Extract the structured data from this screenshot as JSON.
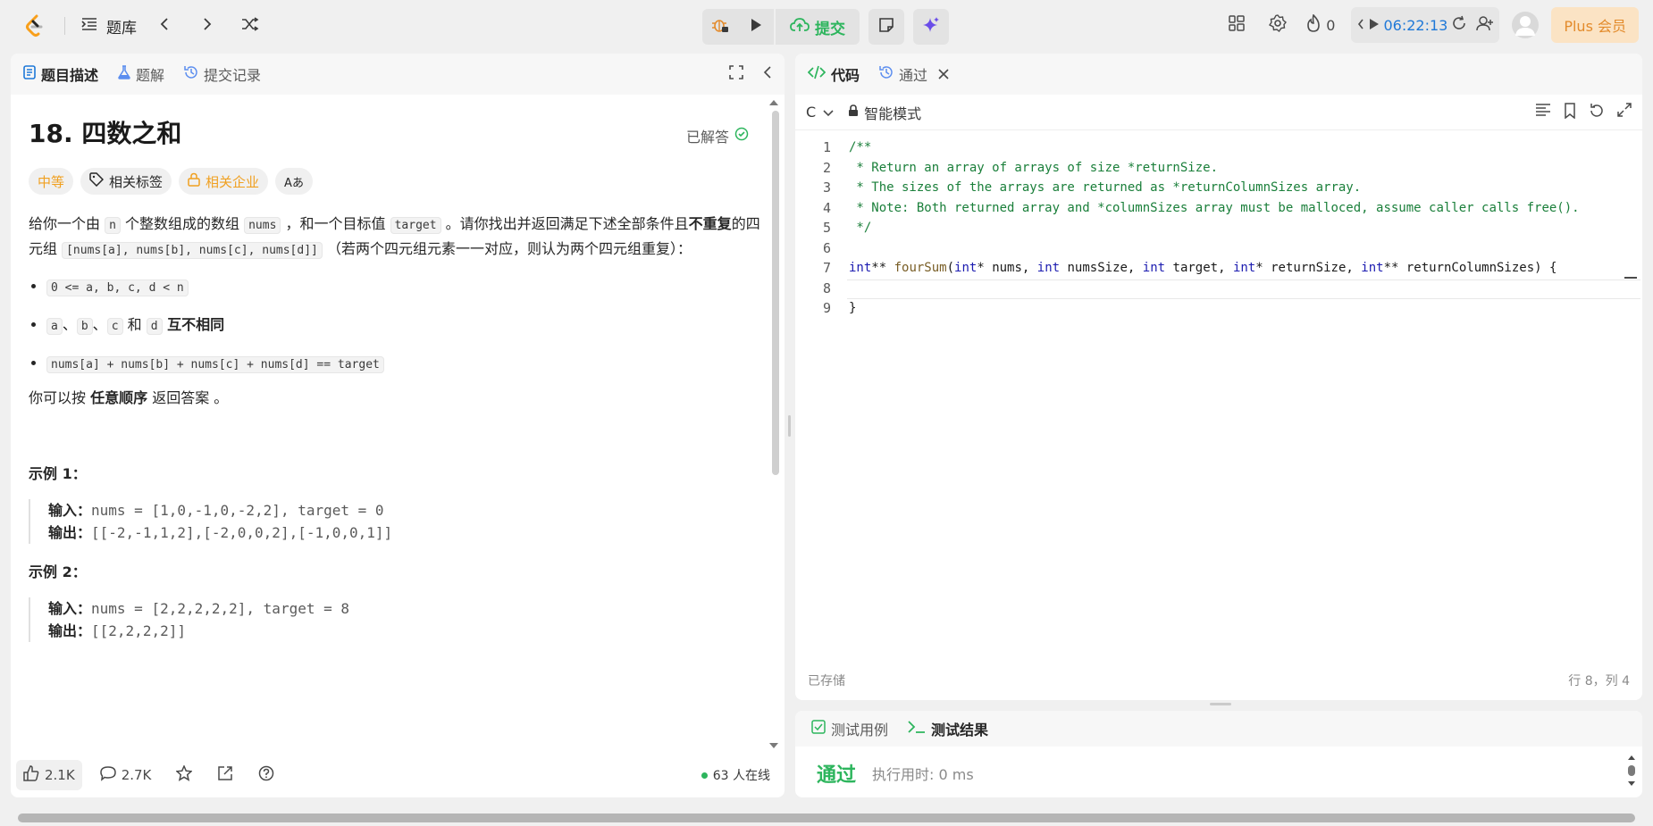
{
  "topbar": {
    "nav_label": "题库",
    "submit_label": "提交",
    "streak_count": "0",
    "timer": "06:22:13",
    "plus_label": "Plus 会员"
  },
  "left_panel": {
    "tabs": [
      "题目描述",
      "题解",
      "提交记录"
    ],
    "problem_title": "18. 四数之和",
    "solved_label": "已解答",
    "tags": {
      "difficulty": "中等",
      "related_tags": "相关标签",
      "related_companies": "相关企业",
      "font_toggle": "Aあ"
    },
    "description": {
      "p1_a": "给你一个由 ",
      "p1_n": "n",
      "p1_b": " 个整数组成的数组 ",
      "p1_nums": "nums",
      "p1_c": " ，和一个目标值 ",
      "p1_target": "target",
      "p1_d": " 。请你找出并返回满足下述全部条件且",
      "p1_bold": "不重复",
      "p1_e": "的四元组 ",
      "p1_quad": "[nums[a], nums[b], nums[c], nums[d]]",
      "p1_f": " （若两个四元组元素一一对应，则认为两个四元组重复）：",
      "cond1": "0 <= a, b, c, d < n",
      "cond2_a": "a",
      "cond2_sep1": "、",
      "cond2_b": "b",
      "cond2_sep2": "、",
      "cond2_c": "c",
      "cond2_and": " 和 ",
      "cond2_d": "d",
      "cond2_bold": " 互不相同",
      "cond3": "nums[a] + nums[b] + nums[c] + nums[d] == target",
      "p2_a": "你可以按 ",
      "p2_bold": "任意顺序",
      "p2_b": " 返回答案 。"
    },
    "examples": [
      {
        "title": "示例 1：",
        "input_label": "输入：",
        "input": "nums = [1,0,-1,0,-2,2], target = 0",
        "output_label": "输出：",
        "output": "[[-2,-1,1,2],[-2,0,0,2],[-1,0,0,1]]"
      },
      {
        "title": "示例 2：",
        "input_label": "输入：",
        "input": "nums = [2,2,2,2,2], target = 8",
        "output_label": "输出：",
        "output": "[[2,2,2,2]]"
      }
    ],
    "footer": {
      "likes": "2.1K",
      "comments": "2.7K",
      "online": "63 人在线"
    }
  },
  "editor": {
    "tabs": [
      "代码",
      "通过"
    ],
    "language": "C",
    "mode": "智能模式",
    "line_numbers": [
      "1",
      "2",
      "3",
      "4",
      "5",
      "6",
      "7",
      "8",
      "9"
    ],
    "code": {
      "l1": "/**",
      "l2": " * Return an array of arrays of size *returnSize.",
      "l3": " * The sizes of the arrays are returned as *returnColumnSizes array.",
      "l4": " * Note: Both returned array and *columnSizes array must be malloced, assume caller calls free().",
      "l5": " */",
      "l7_kw1": "int",
      "l7_a": "** ",
      "l7_fn": "fourSum",
      "l7_b": "(",
      "l7_kw2": "int",
      "l7_c": "* nums, ",
      "l7_kw3": "int",
      "l7_d": " numsSize, ",
      "l7_kw4": "int",
      "l7_e": " target, ",
      "l7_kw5": "int",
      "l7_f": "* returnSize, ",
      "l7_kw6": "int",
      "l7_g": "** returnColumnSizes) {",
      "l9": "}"
    },
    "status": "已存储",
    "cursor_pos": "行 8，列 4"
  },
  "result_panel": {
    "tabs": [
      "测试用例",
      "测试结果"
    ],
    "verdict": "通过",
    "exec_time": "执行用时: 0 ms"
  },
  "colors": {
    "accent_green": "#2db55d",
    "timer_blue": "#1e78d8",
    "medium_orange": "#f0a020"
  }
}
